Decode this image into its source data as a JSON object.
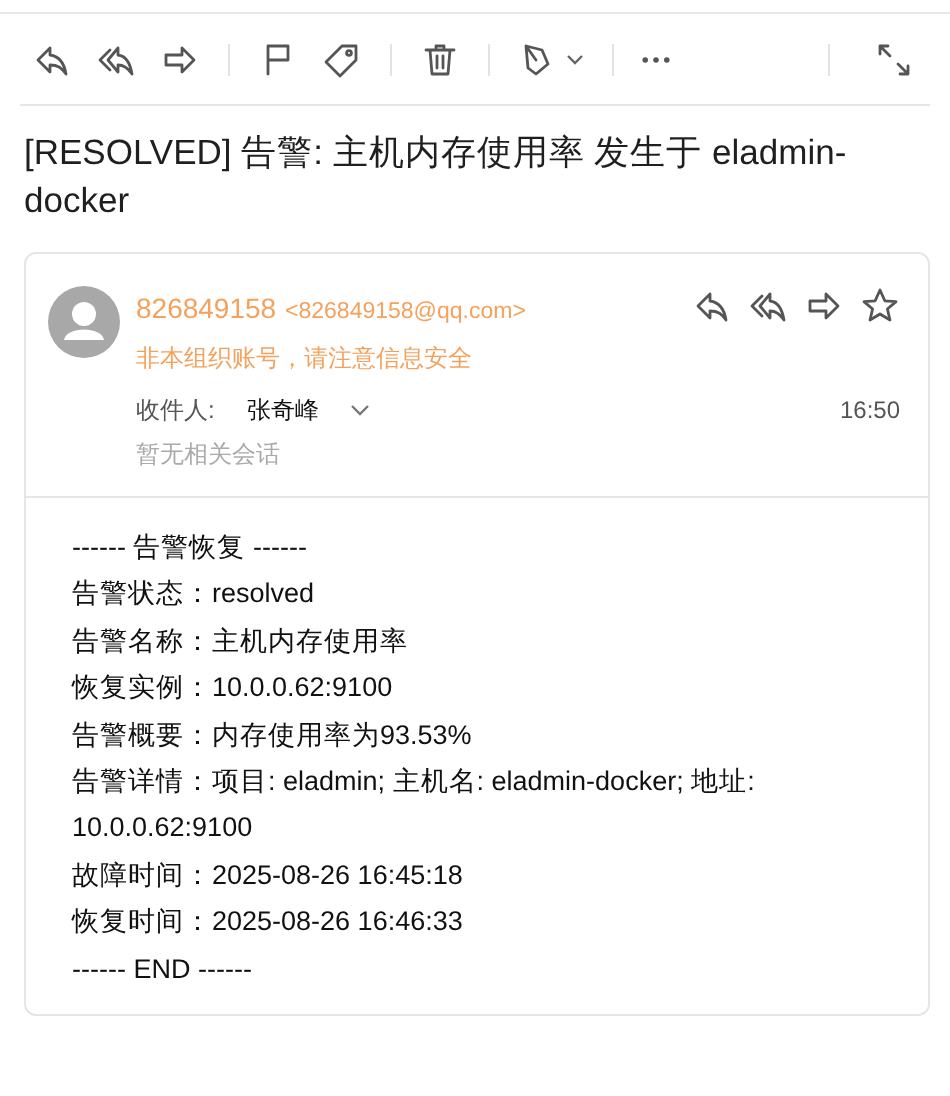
{
  "subject": "[RESOLVED] 告警: 主机内存使用率 发生于 eladmin-docker",
  "message": {
    "sender_name": "826849158",
    "sender_address": "<826849158@qq.com>",
    "warning": "非本组织账号，请注意信息安全",
    "recipient_label": "收件人:",
    "recipient": "张奇峰",
    "time": "16:50",
    "conversation_note": "暂无相关会话",
    "body_lines": [
      "------ 告警恢复 ------",
      "告警状态：resolved",
      "告警名称：主机内存使用率",
      "恢复实例：10.0.0.62:9100",
      "告警概要：内存使用率为93.53%",
      "告警详情：项目: eladmin; 主机名: eladmin-docker; 地址: 10.0.0.62:9100",
      "故障时间：2025-08-26 16:45:18",
      "恢复时间：2025-08-26 16:46:33",
      "------ END ------"
    ]
  }
}
